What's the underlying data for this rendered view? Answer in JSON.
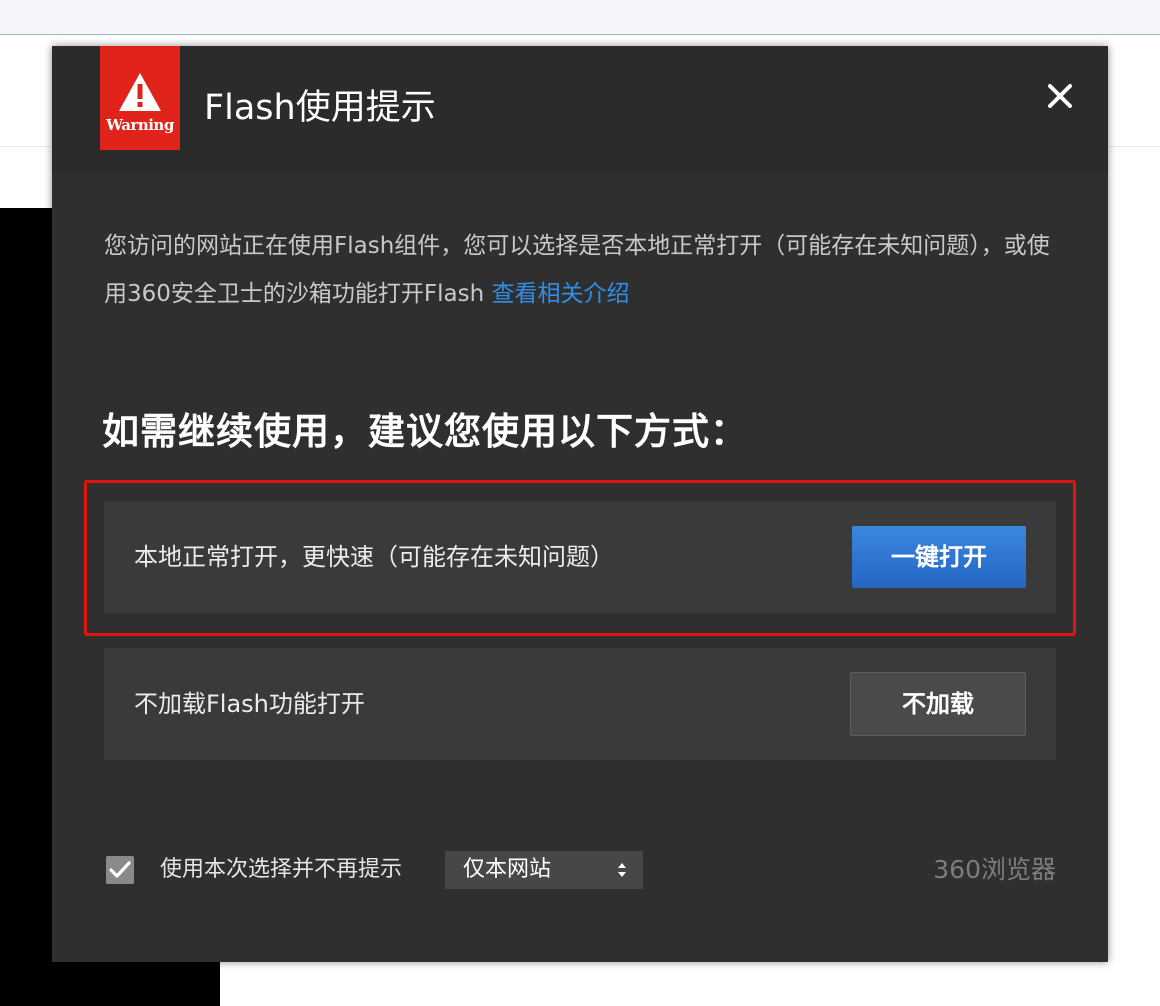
{
  "dialog": {
    "title": "Flash使用提示",
    "badge_text": "Warning",
    "close_icon": "close-icon",
    "description": "您访问的网站正在使用Flash组件，您可以选择是否本地正常打开（可能存在未知问题），或使用360安全卫士的沙箱功能打开Flash",
    "link_text": "查看相关介绍",
    "subheading": "如需继续使用，建议您使用以下方式："
  },
  "options": [
    {
      "label": "本地正常打开，更快速（可能存在未知问题）",
      "button": "一键打开",
      "highlighted": true
    },
    {
      "label": "不加载Flash功能打开",
      "button": "不加载",
      "highlighted": false
    }
  ],
  "footer": {
    "remember_label": "使用本次选择并不再提示",
    "remember_checked": true,
    "scope_value": "仅本网站",
    "brand": "360浏览器"
  },
  "colors": {
    "dialog_bg": "#2f2f2f",
    "warning_red": "#e0241b",
    "highlight_border": "#e3140f",
    "primary_button": "#2f76d4",
    "link": "#2f8fe6"
  }
}
